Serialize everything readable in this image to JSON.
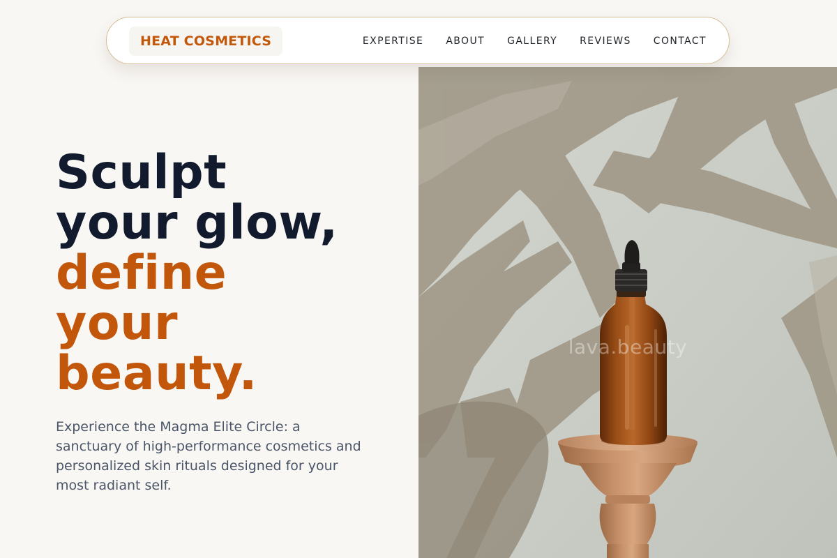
{
  "brand": {
    "name": "HEAT COSMETICS"
  },
  "nav": {
    "items": [
      {
        "label": "EXPERTISE"
      },
      {
        "label": "ABOUT"
      },
      {
        "label": "GALLERY"
      },
      {
        "label": "REVIEWS"
      },
      {
        "label": "CONTACT"
      }
    ]
  },
  "hero": {
    "headline_dark": [
      "Sculpt",
      "your glow,"
    ],
    "headline_accent": [
      "define",
      "your",
      "beauty."
    ],
    "subcopy": "Experience the Magma Elite Circle: a sanctuary of high-performance cosmetics and personalized skin rituals designed for your most radiant self.",
    "image_watermark": "lava.beauty"
  },
  "colors": {
    "accent": "#c2560a",
    "headline_dark": "#121a2e",
    "body_text": "#4a5567",
    "background": "#f9f7f4",
    "nav_border": "#d6bc96"
  }
}
